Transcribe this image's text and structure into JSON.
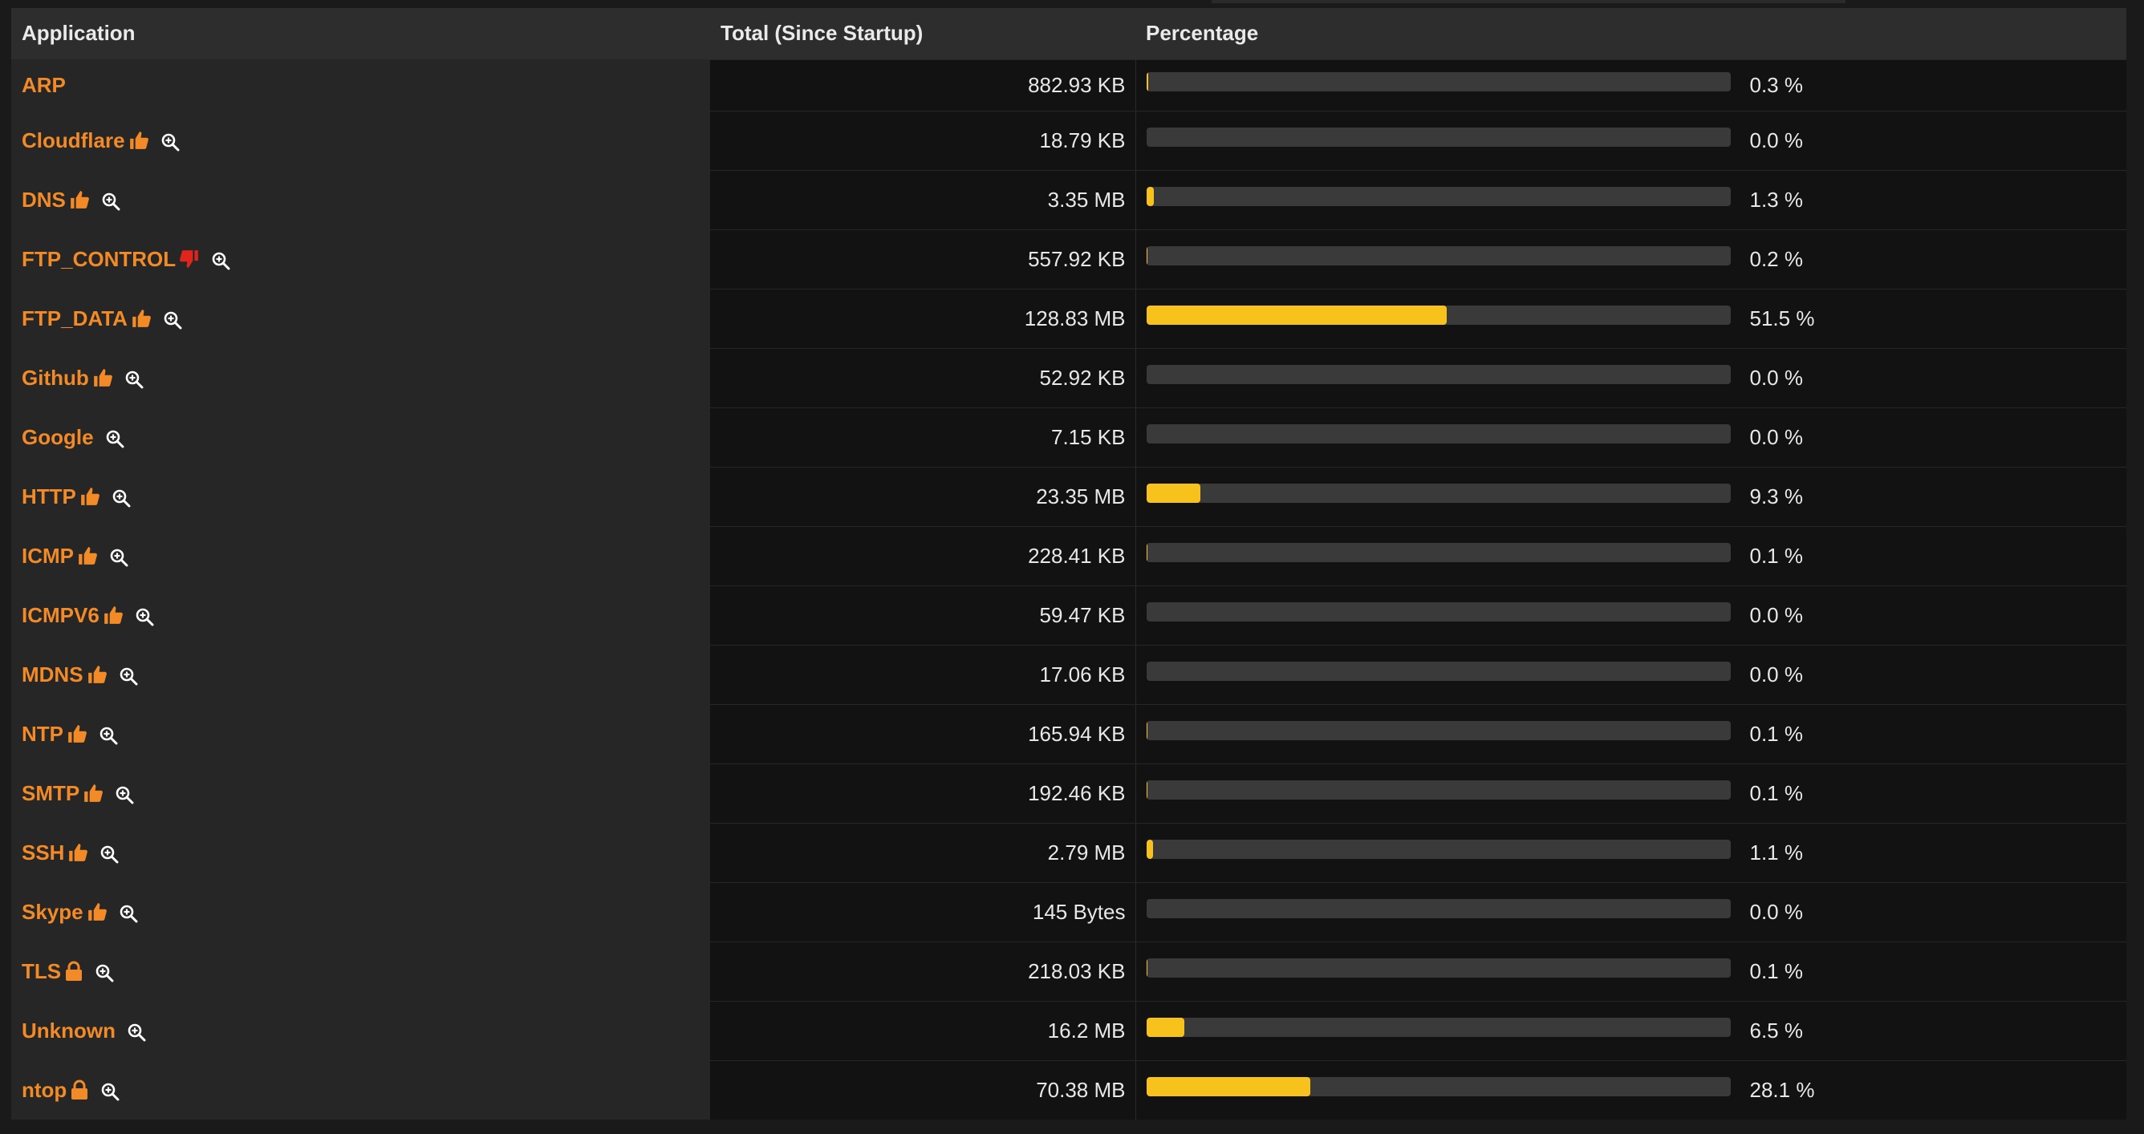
{
  "colors": {
    "accent": "#f28a27",
    "bar_fill": "#f7c21b",
    "bar_track": "#3a3a3a",
    "thumbs_down": "#e0251c"
  },
  "table": {
    "headers": {
      "application": "Application",
      "total": "Total (Since Startup)",
      "percentage": "Percentage"
    },
    "rows": [
      {
        "app": "ARP",
        "badge": "none",
        "zoom": false,
        "total": "882.93 KB",
        "pct": 0.3,
        "pct_label": "0.3 %"
      },
      {
        "app": "Cloudflare",
        "badge": "thumbs-up-icon",
        "zoom": true,
        "total": "18.79 KB",
        "pct": 0.0,
        "pct_label": "0.0 %"
      },
      {
        "app": "DNS",
        "badge": "thumbs-up-icon",
        "zoom": true,
        "total": "3.35 MB",
        "pct": 1.3,
        "pct_label": "1.3 %"
      },
      {
        "app": "FTP_CONTROL",
        "badge": "thumbs-down-icon",
        "zoom": true,
        "total": "557.92 KB",
        "pct": 0.2,
        "pct_label": "0.2 %"
      },
      {
        "app": "FTP_DATA",
        "badge": "thumbs-up-icon",
        "zoom": true,
        "total": "128.83 MB",
        "pct": 51.5,
        "pct_label": "51.5 %"
      },
      {
        "app": "Github",
        "badge": "thumbs-up-icon",
        "zoom": true,
        "total": "52.92 KB",
        "pct": 0.0,
        "pct_label": "0.0 %"
      },
      {
        "app": "Google",
        "badge": "none",
        "zoom": true,
        "total": "7.15 KB",
        "pct": 0.0,
        "pct_label": "0.0 %"
      },
      {
        "app": "HTTP",
        "badge": "thumbs-up-icon",
        "zoom": true,
        "total": "23.35 MB",
        "pct": 9.3,
        "pct_label": "9.3 %"
      },
      {
        "app": "ICMP",
        "badge": "thumbs-up-icon",
        "zoom": true,
        "total": "228.41 KB",
        "pct": 0.1,
        "pct_label": "0.1 %"
      },
      {
        "app": "ICMPV6",
        "badge": "thumbs-up-icon",
        "zoom": true,
        "total": "59.47 KB",
        "pct": 0.0,
        "pct_label": "0.0 %"
      },
      {
        "app": "MDNS",
        "badge": "thumbs-up-icon",
        "zoom": true,
        "total": "17.06 KB",
        "pct": 0.0,
        "pct_label": "0.0 %"
      },
      {
        "app": "NTP",
        "badge": "thumbs-up-icon",
        "zoom": true,
        "total": "165.94 KB",
        "pct": 0.1,
        "pct_label": "0.1 %"
      },
      {
        "app": "SMTP",
        "badge": "thumbs-up-icon",
        "zoom": true,
        "total": "192.46 KB",
        "pct": 0.1,
        "pct_label": "0.1 %"
      },
      {
        "app": "SSH",
        "badge": "thumbs-up-icon",
        "zoom": true,
        "total": "2.79 MB",
        "pct": 1.1,
        "pct_label": "1.1 %"
      },
      {
        "app": "Skype",
        "badge": "thumbs-up-icon",
        "zoom": true,
        "total": "145 Bytes",
        "pct": 0.0,
        "pct_label": "0.0 %"
      },
      {
        "app": "TLS",
        "badge": "lock-icon",
        "zoom": true,
        "total": "218.03 KB",
        "pct": 0.1,
        "pct_label": "0.1 %"
      },
      {
        "app": "Unknown",
        "badge": "none",
        "zoom": true,
        "total": "16.2 MB",
        "pct": 6.5,
        "pct_label": "6.5 %"
      },
      {
        "app": "ntop",
        "badge": "lock-icon",
        "zoom": true,
        "total": "70.38 MB",
        "pct": 28.1,
        "pct_label": "28.1 %"
      }
    ]
  }
}
